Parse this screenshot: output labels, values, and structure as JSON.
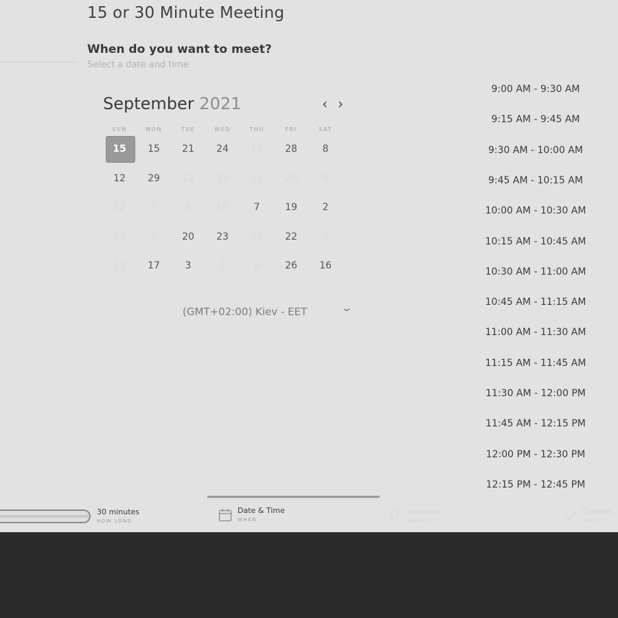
{
  "header": {
    "title": "15 or 30 Minute Meeting",
    "question": "When do you want to meet?",
    "hint": "Select a date and time"
  },
  "calendar": {
    "month": "September",
    "year": "2021",
    "weekdays": [
      "SUN",
      "MON",
      "TUE",
      "WED",
      "THU",
      "FRI",
      "SAT"
    ],
    "rows": [
      [
        {
          "t": "15",
          "s": "selected"
        },
        {
          "t": "15",
          "s": "enabled"
        },
        {
          "t": "21",
          "s": "enabled"
        },
        {
          "t": "24",
          "s": "enabled"
        },
        {
          "t": "16",
          "s": "disabled"
        },
        {
          "t": "28",
          "s": "enabled"
        },
        {
          "t": "8",
          "s": "enabled"
        }
      ],
      [
        {
          "t": "12",
          "s": "enabled"
        },
        {
          "t": "29",
          "s": "enabled"
        },
        {
          "t": "13",
          "s": "disabled"
        },
        {
          "t": "19",
          "s": "disabled"
        },
        {
          "t": "13",
          "s": "disabled"
        },
        {
          "t": "26",
          "s": "disabled"
        },
        {
          "t": "8",
          "s": "disabled"
        }
      ],
      [
        {
          "t": "12",
          "s": "disabled"
        },
        {
          "t": "5",
          "s": "disabled"
        },
        {
          "t": "6",
          "s": "disabled"
        },
        {
          "t": "10",
          "s": "disabled"
        },
        {
          "t": "7",
          "s": "enabled"
        },
        {
          "t": "19",
          "s": "enabled"
        },
        {
          "t": "2",
          "s": "enabled"
        }
      ],
      [
        {
          "t": "24",
          "s": "disabled"
        },
        {
          "t": "9",
          "s": "disabled"
        },
        {
          "t": "20",
          "s": "enabled"
        },
        {
          "t": "23",
          "s": "enabled"
        },
        {
          "t": "20",
          "s": "disabled"
        },
        {
          "t": "22",
          "s": "enabled"
        },
        {
          "t": "3",
          "s": "disabled"
        }
      ],
      [
        {
          "t": "13",
          "s": "disabled"
        },
        {
          "t": "17",
          "s": "enabled"
        },
        {
          "t": "3",
          "s": "enabled"
        },
        {
          "t": "1",
          "s": "disabled"
        },
        {
          "t": "8",
          "s": "disabled"
        },
        {
          "t": "26",
          "s": "enabled"
        },
        {
          "t": "16",
          "s": "enabled"
        }
      ]
    ],
    "prev_icon": "chevron-left-icon",
    "next_icon": "chevron-right-icon"
  },
  "timezone": {
    "label": "(GMT+02:00) Kiev - EET",
    "icon": "chevron-down-icon"
  },
  "time_slots": [
    "9:00 AM - 9:30 AM",
    "9:15 AM - 9:45 AM",
    "9:30 AM - 10:00 AM",
    "9:45 AM - 10:15 AM",
    "10:00 AM - 10:30 AM",
    "10:15 AM - 10:45 AM",
    "10:30 AM - 11:00 AM",
    "10:45 AM - 11:15 AM",
    "11:00 AM - 11:30 AM",
    "11:15 AM - 11:45 AM",
    "11:30 AM - 12:00 PM",
    "11:45 AM - 12:15 PM",
    "12:00 PM - 12:30 PM",
    "12:15 PM - 12:45 PM"
  ],
  "steps": [
    {
      "label": "30 minutes",
      "sub": "HOW LONG",
      "icon": "duration-bar-icon",
      "state": "done"
    },
    {
      "label": "Date & Time",
      "sub": "WHEN",
      "icon": "calendar-icon",
      "state": "active"
    },
    {
      "label": "Location",
      "sub": "WHERE",
      "icon": "location-icon",
      "state": "upcoming"
    },
    {
      "label": "Confirm",
      "sub": "INFO",
      "icon": "confirm-icon",
      "state": "upcoming"
    }
  ],
  "colors": {
    "panel": "#e2e2e2",
    "footer": "#2a2a2a",
    "selected_day": "#999999"
  }
}
